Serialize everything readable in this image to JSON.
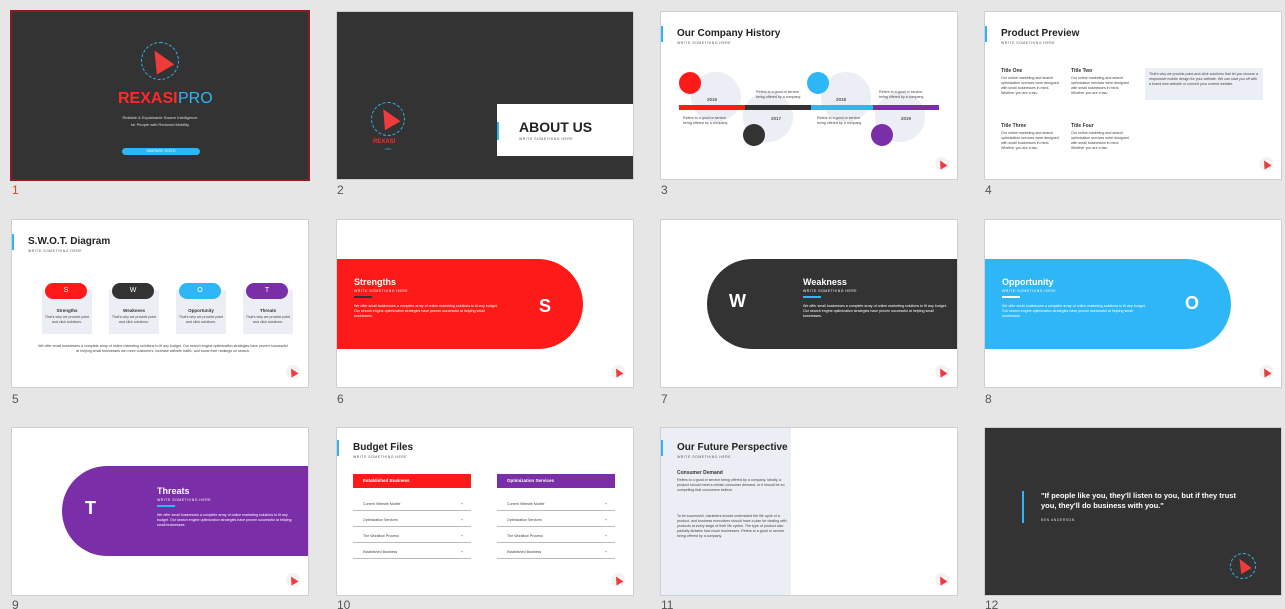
{
  "slides": [
    {
      "number": "1",
      "brand_red": "REXASI",
      "brand_blue": "PRO",
      "tagline": "Reliable & Explainable Swarm Intelligence",
      "tagline2": "for People with Reduced Mobility",
      "button": "INSERIRE TESTO"
    },
    {
      "number": "2",
      "heading": "ABOUT US",
      "subheading": "WRITE SOMETHING HERE",
      "brand": "REXASI",
      "brand_sub": "PRO"
    },
    {
      "number": "3",
      "heading": "Our Company History",
      "subheading": "WRITE SOMETHING HERE",
      "years": [
        "2016",
        "2017",
        "2018",
        "2019"
      ],
      "text": "Refers to a good or service being offered by a company."
    },
    {
      "number": "4",
      "heading": "Product Preview",
      "subheading": "WRITE SOMETHING HERE",
      "items": [
        "Title One",
        "Title Two",
        "Title Three",
        "Title Four"
      ],
      "item_text": "Our online marketing and search optimization services were designed with small businesses in mind. Whether you are a bsu",
      "side_text": "That's why we provide point-and-click solutions that let you choose a responsive mobile design for your website. We can start you off with a brand new website or convert your current website."
    },
    {
      "number": "5",
      "heading": "S.W.O.T. Diagram",
      "subheading": "WRITE SOMETHING HERE",
      "letters": [
        "S",
        "W",
        "O",
        "T"
      ],
      "labels": [
        "Strengths",
        "Weakness",
        "Opportunity",
        "Threats"
      ],
      "card_text": "That's why we provide point and click solutions.",
      "footer": "We offer small businesses a complete array of online marketing solutions to fit any budget. Our search engine optimization strategies have proven successful at helping small businesses win more customers, increase website traffic, and boost their rankings on search."
    },
    {
      "number": "6",
      "heading": "Strengths",
      "letter": "S"
    },
    {
      "number": "7",
      "heading": "Weakness",
      "letter": "W"
    },
    {
      "number": "8",
      "heading": "Opportunity",
      "letter": "O"
    },
    {
      "number": "9",
      "heading": "Threats",
      "letter": "T"
    },
    {
      "number": "10",
      "heading": "Budget Files",
      "subheading": "WRITE SOMETHING HERE",
      "col1": "Established Business",
      "col2": "Optimization Services",
      "rows": [
        "Current Website Mobile",
        "Optimization Services",
        "The Workflow Process",
        "Established Business"
      ],
      "plus": "+"
    },
    {
      "number": "11",
      "heading": "Our Future Perspective",
      "subheading": "WRITE SOMETHING HERE",
      "subtitle": "Consumer Demand",
      "p1": "Refers to a good or service being offered by a company. Ideally, a product should meet a certain consumer demand, or it should be so compelling that consumers believe",
      "p2": "To be successful, marketers should understand the life cycle of a product, and business executives should have a plan for dealing with products at every stage of their life cycles. The type of product also partially dictates how much businesses. Refers to a good or service being offered by a company."
    },
    {
      "number": "12",
      "quote": "\"If people like you, they'll listen to you, but if they trust you, they'll do business with you.\"",
      "author": "BEN ANDERSON"
    }
  ],
  "panel_subtitle": "WRITE SOMETHING HERE",
  "panel_body": "We offer small businesses a complete array of online marketing solutions to fit any budget. Our search engine optimization strategies have proven successful at helping small businesses.",
  "colors": {
    "red": "#ff1a1a",
    "dark": "#333333",
    "blue": "#2fb6f6",
    "purple": "#7a2ea8",
    "accent": "#2fb6f6"
  }
}
